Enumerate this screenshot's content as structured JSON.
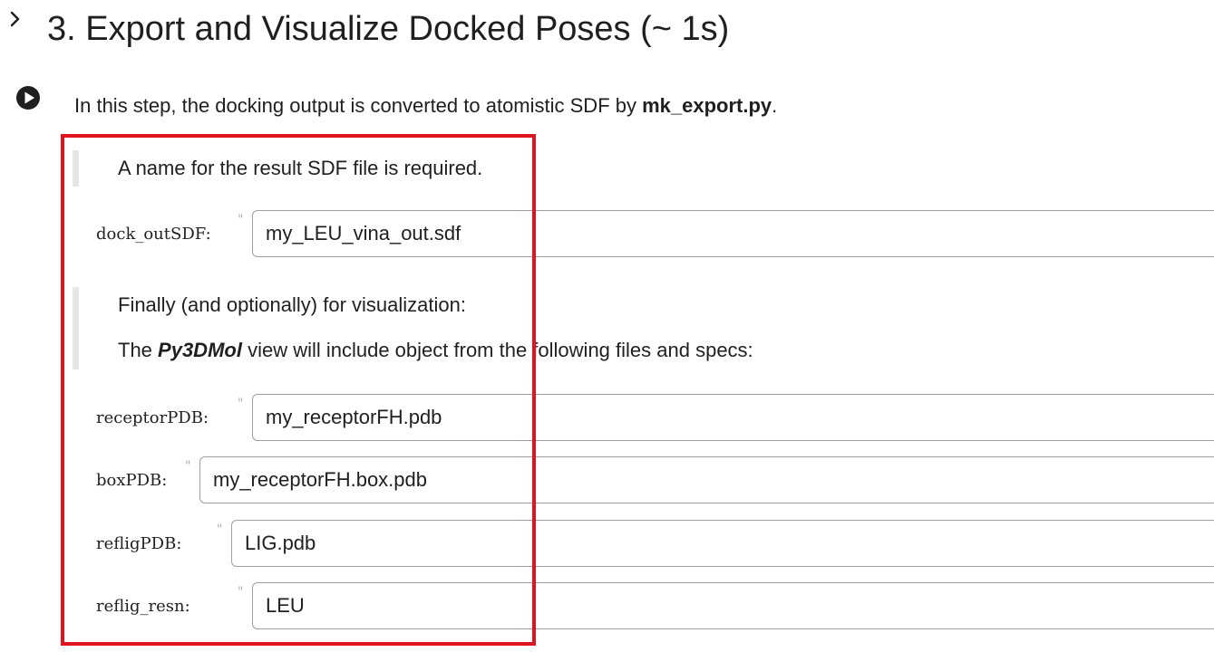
{
  "section": {
    "title": "3. Export and Visualize Docked Poses (~ 1s)",
    "collapse_icon": "chevron-right-icon",
    "run_icon": "play-circle-icon"
  },
  "intro": {
    "prefix": "In this step, the docking output is converted to atomistic SDF by ",
    "script_name": "mk_export.py",
    "suffix": "."
  },
  "notes": {
    "result_note": "A name for the result SDF file is required.",
    "vis_note_1": "Finally (and optionally) for visualization:",
    "vis_note_2_prefix": "The ",
    "vis_note_2_emph": "Py3DMol",
    "vis_note_2_suffix": " view will include object from the following files and specs:"
  },
  "params": {
    "dock_outSDF": {
      "label": "dock_outSDF:",
      "value": "my_LEU_vina_out.sdf"
    },
    "receptorPDB": {
      "label": "receptorPDB:",
      "value": "my_receptorFH.pdb"
    },
    "boxPDB": {
      "label": "boxPDB:",
      "value": "my_receptorFH.box.pdb"
    },
    "refligPDB": {
      "label": "refligPDB:",
      "value": "LIG.pdb"
    },
    "reflig_resn": {
      "label": "reflig_resn:",
      "value": "LEU"
    }
  },
  "colors": {
    "highlight": "#e0141e",
    "text": "#1f1f1f",
    "input_border": "#9e9e9e",
    "quote_bar": "#e6e6e6"
  }
}
